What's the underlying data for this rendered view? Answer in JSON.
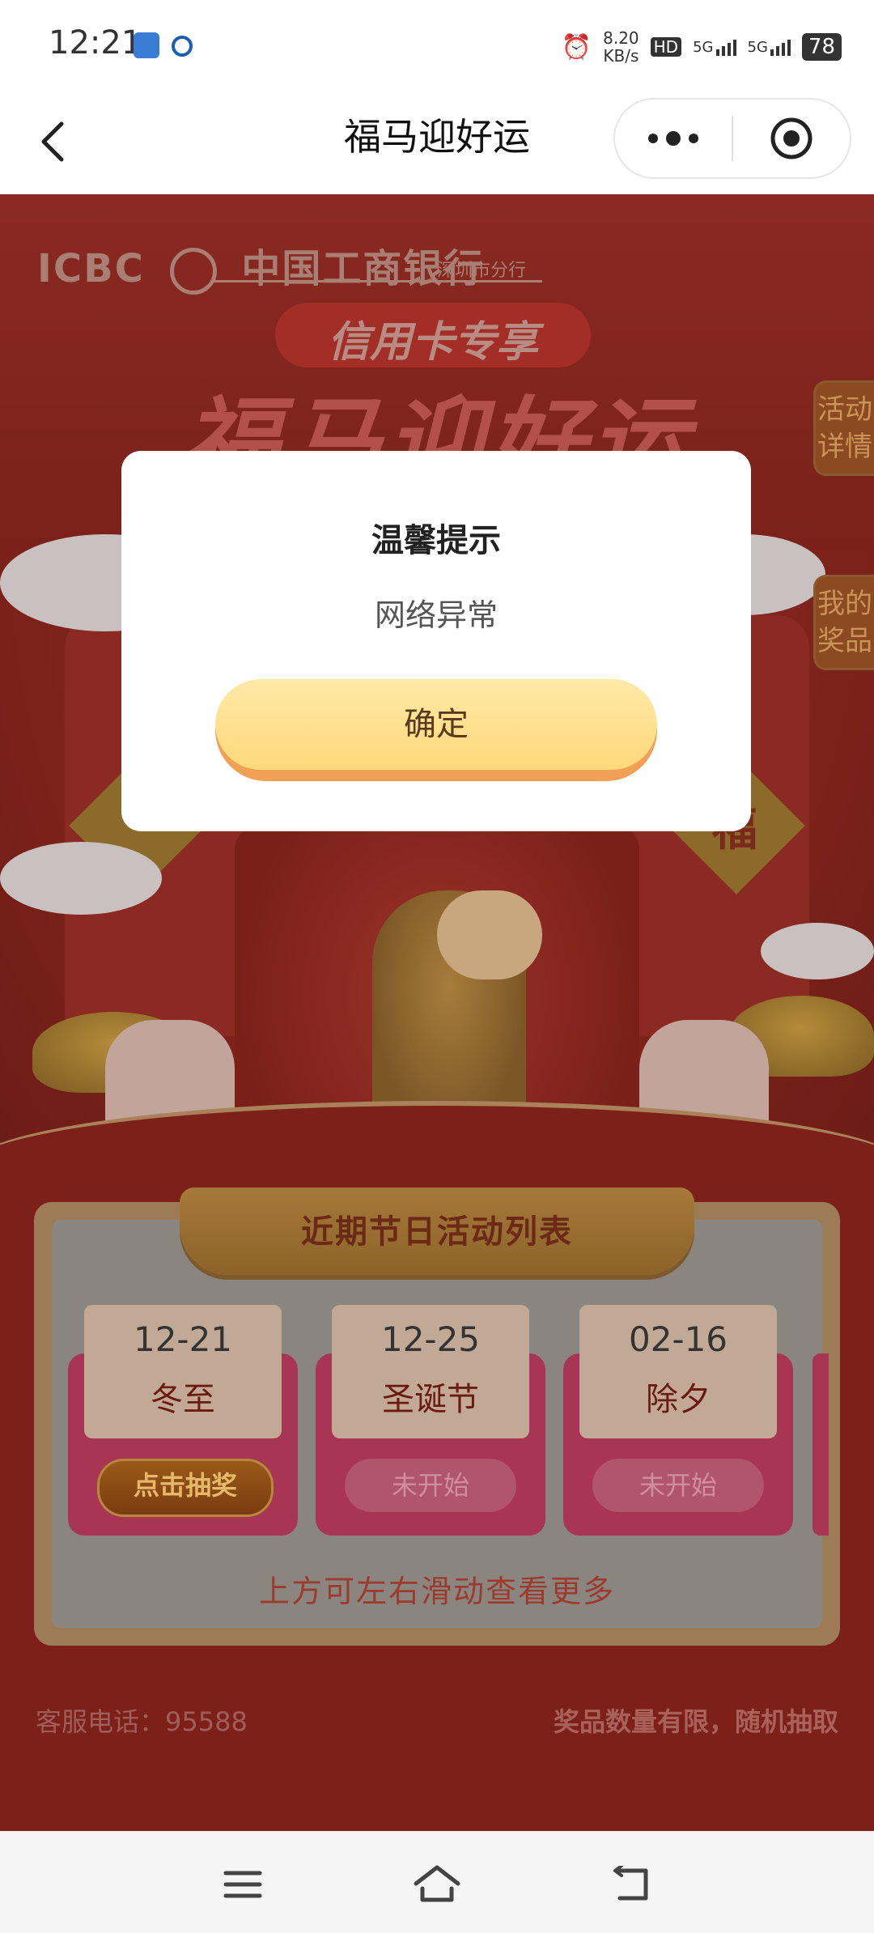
{
  "status_bar": {
    "time": "12:21",
    "net_speed_value": "8.20",
    "net_speed_unit": "KB/s",
    "hd_label": "HD",
    "sim1_label": "5G",
    "sim2_label": "5G",
    "battery": "78"
  },
  "titlebar": {
    "title": "福马迎好运"
  },
  "banner": {
    "bank_en": "ICBC",
    "bank_cn": "中国工商银行",
    "branch": "深圳市分行",
    "promo_tag": "信用卡专享",
    "hero_title": "福马迎好运",
    "lantern_char": "福",
    "side_details": "活动详情",
    "side_prizes": "我的奖品"
  },
  "events": {
    "title": "近期节日活动列表",
    "items": [
      {
        "date": "12-21",
        "name": "冬至",
        "button": "点击抽奖",
        "active": true
      },
      {
        "date": "12-25",
        "name": "圣诞节",
        "button": "未开始",
        "active": false
      },
      {
        "date": "02-16",
        "name": "除夕",
        "button": "未开始",
        "active": false
      }
    ],
    "scroll_hint": "上方可左右滑动查看更多"
  },
  "footer": {
    "service_phone": "客服电话：95588",
    "notice": "奖品数量有限，随机抽取"
  },
  "modal": {
    "title": "温馨提示",
    "message": "网络异常",
    "confirm": "确定"
  },
  "colors": {
    "page_bg": "#7e201a",
    "modal_button": "#ffd97a",
    "panel_gold": "#9e7b57"
  }
}
